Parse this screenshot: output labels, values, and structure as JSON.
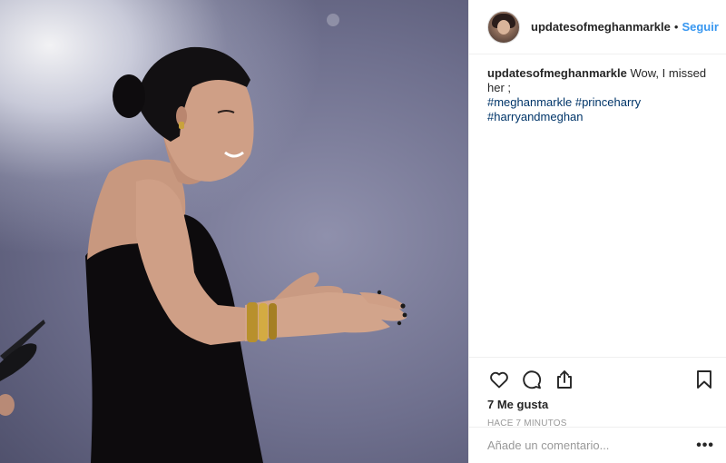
{
  "post": {
    "photo_alt": "Photo"
  },
  "header": {
    "username": "updatesofmeghanmarkle",
    "separator": "•",
    "follow_label": "Seguir"
  },
  "caption": {
    "username": "updatesofmeghanmarkle",
    "text": "Wow, I missed her ;",
    "hashtags": [
      "#meghanmarkle",
      "#princeharry",
      "#harryandmeghan"
    ]
  },
  "actions": {
    "icons": [
      "heart-icon",
      "comment-icon",
      "share-icon",
      "bookmark-icon"
    ],
    "likes": "7 Me gusta",
    "time": "HACE 7 MINUTOS"
  },
  "comment": {
    "placeholder": "Añade un comentario...",
    "more_label": "•••"
  },
  "colors": {
    "accent": "#3897f0",
    "hashtag": "#003569",
    "text": "#262626",
    "muted": "#999999",
    "divider": "#efefef"
  }
}
